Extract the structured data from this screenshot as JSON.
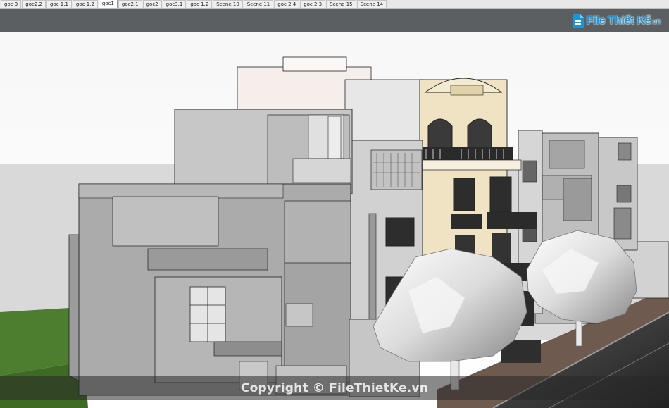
{
  "scene_tabs": [
    {
      "label": "goc 3",
      "active": false
    },
    {
      "label": "goc2.2",
      "active": false
    },
    {
      "label": "goc 1.1",
      "active": false
    },
    {
      "label": "goc 1.2",
      "active": false
    },
    {
      "label": "goc1",
      "active": true
    },
    {
      "label": "goc2.1",
      "active": false
    },
    {
      "label": "goc2",
      "active": false
    },
    {
      "label": "goc3.1",
      "active": false
    },
    {
      "label": "goc 1.2",
      "active": false
    },
    {
      "label": "Scene 10",
      "active": false
    },
    {
      "label": "Scene 11",
      "active": false
    },
    {
      "label": "goc 2.4",
      "active": false
    },
    {
      "label": "goc 2.3",
      "active": false
    },
    {
      "label": "Scene 15",
      "active": false
    },
    {
      "label": "Scene 14",
      "active": false
    }
  ],
  "logo": {
    "main": "File Thiết Kế",
    "suffix": ".vn"
  },
  "watermark": "Copyright © FileThietKe.vn",
  "colors": {
    "logo_blue": "#1b95d6",
    "sky": "#ffffff",
    "band": "#5a5e60",
    "ground": "#4b7a2e",
    "road": "#3a3a3a"
  }
}
